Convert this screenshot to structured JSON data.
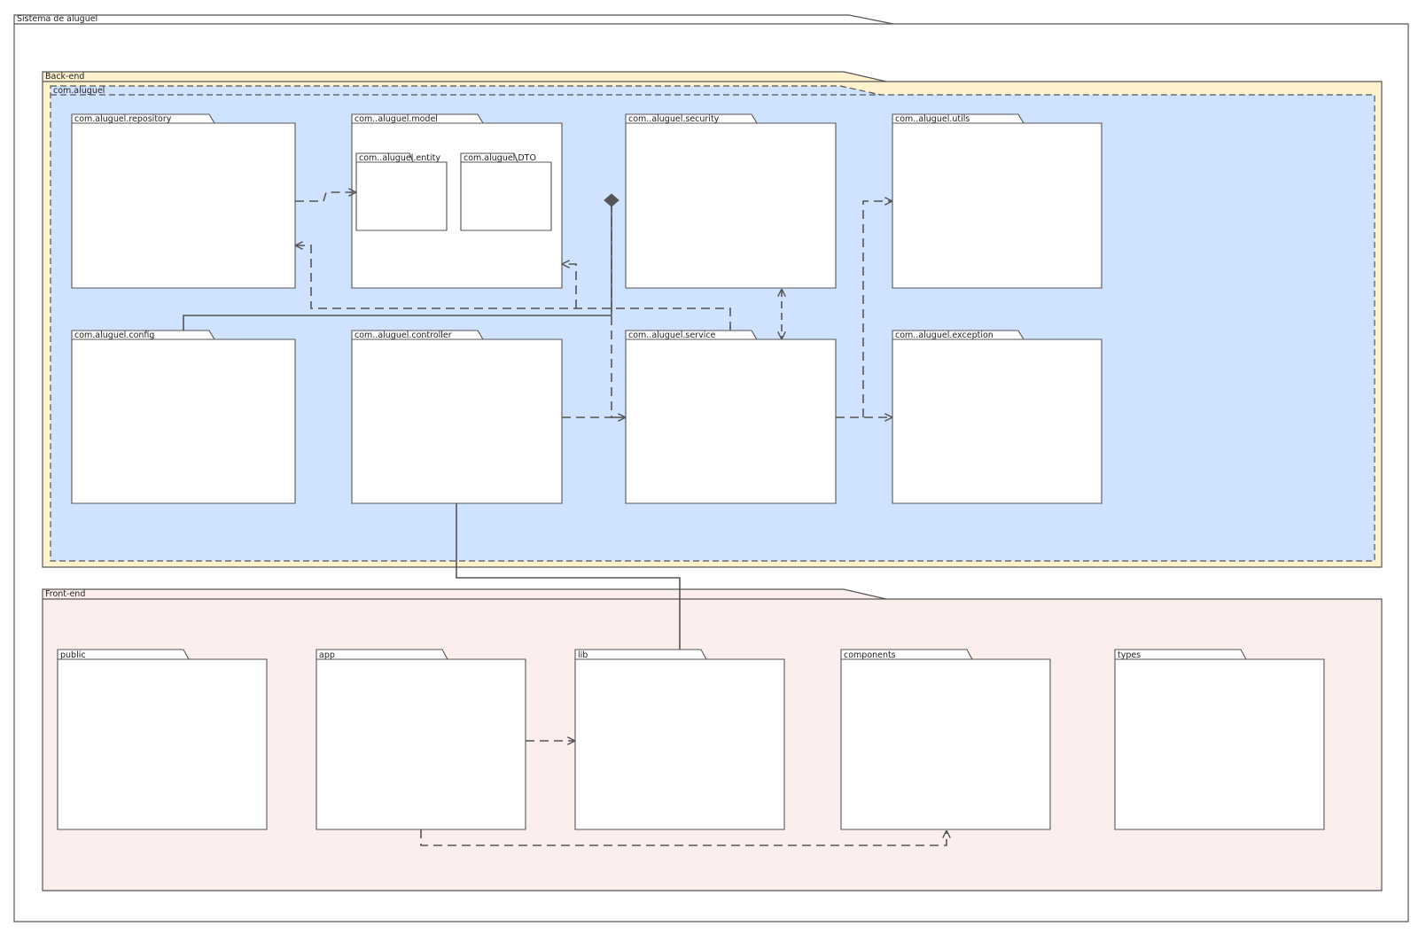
{
  "diagram": {
    "system_title": "Sistema de aluguel",
    "backend": {
      "title": "Back-end",
      "namespace": "com.aluguel",
      "packages": {
        "repository": "com.aluguel.repository",
        "model": "com..aluguel.model",
        "entity": "com..aluguel.entity",
        "dto": "com.aluguel.DTO",
        "security": "com..aluguel.security",
        "utils": "com..aluguel.utils",
        "config": "com.aluguel.config",
        "controller": "com..aluguel.controller",
        "service": "com..aluguel.service",
        "exception": "com..aluguel.exception"
      }
    },
    "frontend": {
      "title": "Front-end",
      "packages": {
        "public": "public",
        "app": "app",
        "lib": "lib",
        "components": "components",
        "types": "types"
      }
    },
    "colors": {
      "backend_fill": "#fff2cc",
      "namespace_fill": "#cfe2ff",
      "frontend_fill": "#fdeeee",
      "package_fill": "#ffffff",
      "line": "#555555"
    }
  }
}
